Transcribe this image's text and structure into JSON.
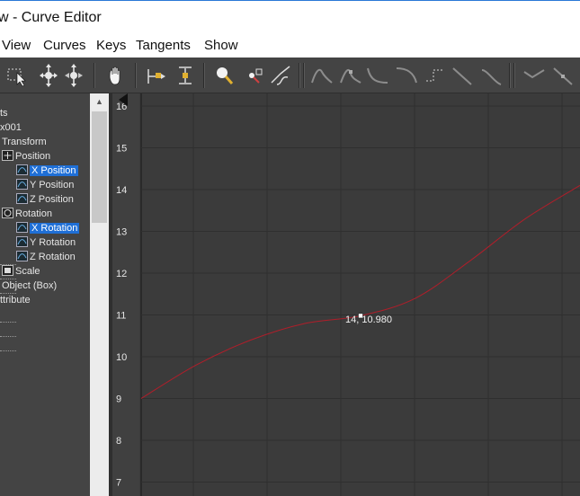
{
  "window": {
    "title": "w - Curve Editor"
  },
  "menu": [
    "View",
    "Curves",
    "Keys",
    "Tangents",
    "Show"
  ],
  "toolbar": [
    "select-region-icon",
    "move-keys-icon",
    "move-keys-horizontal-icon",
    "pan-hand-icon",
    "slide-keys-icon",
    "scale-keys-icon",
    "zoom-icon",
    "zoom-region-icon",
    "curve-tool-icon",
    "tangent-auto-icon",
    "tangent-spline-icon",
    "tangent-fast-icon",
    "tangent-slow-icon",
    "tangent-step-icon",
    "tangent-linear-icon",
    "tangent-smooth-icon",
    "tangent-break-icon",
    "tangent-unify-icon"
  ],
  "tree": [
    {
      "label": "ts",
      "x": 0,
      "icon": "",
      "selected": false
    },
    {
      "label": "x001",
      "x": 0,
      "icon": "",
      "selected": false
    },
    {
      "label": "Transform",
      "x": 2,
      "icon": "",
      "selected": false
    },
    {
      "label": "Position",
      "x": 2,
      "icon": "position-icon",
      "selected": false
    },
    {
      "label": "X Position",
      "x": 18,
      "icon": "controller-icon",
      "selected": true
    },
    {
      "label": "Y Position",
      "x": 18,
      "icon": "controller-icon",
      "selected": false
    },
    {
      "label": "Z Position",
      "x": 18,
      "icon": "controller-icon",
      "selected": false
    },
    {
      "label": "Rotation",
      "x": 2,
      "icon": "rotation-icon",
      "selected": false
    },
    {
      "label": "X Rotation",
      "x": 18,
      "icon": "controller-icon",
      "selected": true
    },
    {
      "label": "Y Rotation",
      "x": 18,
      "icon": "controller-icon",
      "selected": false
    },
    {
      "label": "Z Rotation",
      "x": 18,
      "icon": "controller-icon",
      "selected": false
    },
    {
      "label": "Scale",
      "x": 2,
      "icon": "scale-icon",
      "selected": false
    },
    {
      "label": "Object (Box)",
      "x": 2,
      "icon": "",
      "selected": false
    },
    {
      "label": "ttribute",
      "x": 0,
      "icon": "",
      "selected": false
    }
  ],
  "graph": {
    "y_ticks": [
      "16",
      "15",
      "14",
      "13",
      "12",
      "11",
      "10",
      "9",
      "8",
      "7"
    ],
    "key_readout": "14, 10.980",
    "curve_color": "#b01e2a",
    "key_color": "#ffffff",
    "background": "#3b3b3b",
    "grid_color": "#2f2f2f",
    "curve_y_values": [
      9.0,
      9.8,
      10.4,
      10.8,
      10.98,
      11.4,
      12.3,
      13.3,
      14.1
    ],
    "key_value": 10.98
  }
}
